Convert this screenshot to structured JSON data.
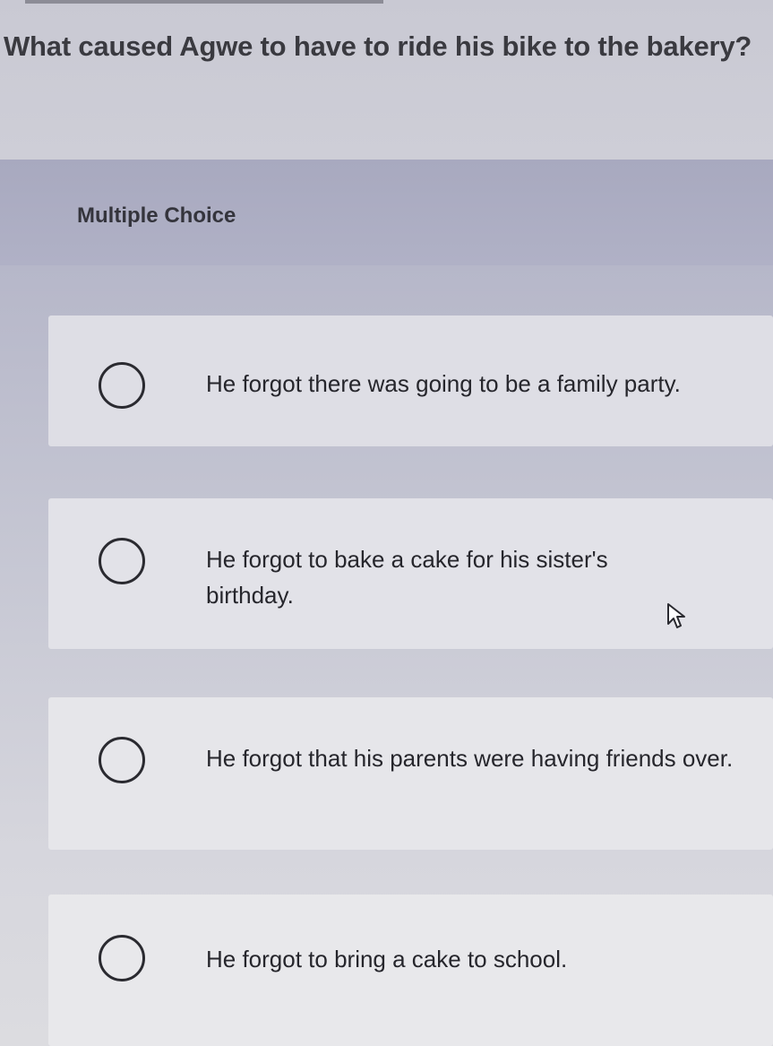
{
  "question": {
    "text": "What caused Agwe to have to ride his bike to the bakery?"
  },
  "question_type": {
    "label": "Multiple Choice"
  },
  "options": [
    {
      "text": "He forgot there was going to be a family party."
    },
    {
      "text": "He forgot to bake a cake for his sister's birthday."
    },
    {
      "text": "He forgot that his parents were having friends over."
    },
    {
      "text": "He forgot to bring a cake to school."
    }
  ],
  "icons": {
    "radio": "radio-unselected-icon",
    "cursor": "mouse-pointer-icon"
  }
}
